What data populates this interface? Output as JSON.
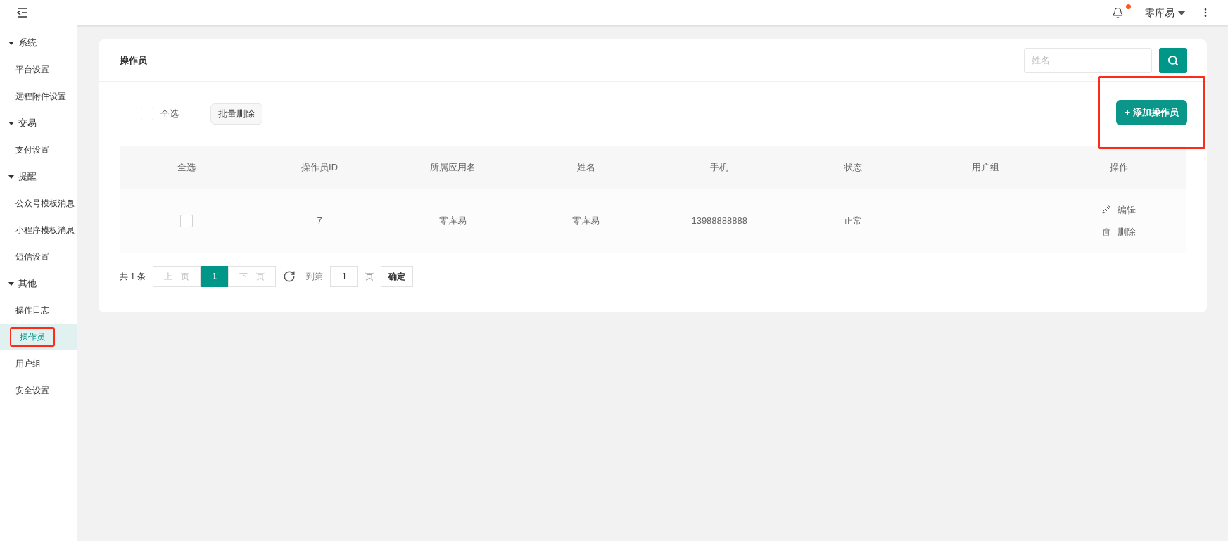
{
  "topbar": {
    "notification_dot": true,
    "user": "零库易"
  },
  "sidebar": {
    "groups": [
      {
        "label": "系统",
        "expanded": true,
        "items": [
          {
            "label": "平台设置",
            "selected": false,
            "highlighted": false
          },
          {
            "label": "远程附件设置",
            "selected": false,
            "highlighted": false
          }
        ]
      },
      {
        "label": "交易",
        "expanded": true,
        "items": [
          {
            "label": "支付设置",
            "selected": false,
            "highlighted": false
          }
        ]
      },
      {
        "label": "提醒",
        "expanded": true,
        "items": [
          {
            "label": "公众号模板消息",
            "selected": false,
            "highlighted": false
          },
          {
            "label": "小程序模板消息",
            "selected": false,
            "highlighted": false
          },
          {
            "label": "短信设置",
            "selected": false,
            "highlighted": false
          }
        ]
      },
      {
        "label": "其他",
        "expanded": true,
        "items": [
          {
            "label": "操作日志",
            "selected": false,
            "highlighted": false
          },
          {
            "label": "操作员",
            "selected": true,
            "highlighted": true
          },
          {
            "label": "用户组",
            "selected": false,
            "highlighted": false
          },
          {
            "label": "安全设置",
            "selected": false,
            "highlighted": false
          }
        ]
      }
    ]
  },
  "panel": {
    "title": "操作员",
    "search": {
      "placeholder": "姓名"
    },
    "toolbar": {
      "select_all": {
        "label": "全选",
        "checked": false
      },
      "bulk_delete": "批量删除",
      "add_button": {
        "label": "+ 添加操作员",
        "highlighted": true
      }
    },
    "table": {
      "columns": [
        "全选",
        "操作员ID",
        "所属应用名",
        "姓名",
        "手机",
        "状态",
        "用户组",
        "操作"
      ],
      "rows": [
        {
          "cells": [
            {
              "kind": "checkbox",
              "checked": false
            },
            {
              "kind": "text",
              "text": "7"
            },
            {
              "kind": "text",
              "text": "零库易"
            },
            {
              "kind": "text",
              "text": "零库易"
            },
            {
              "kind": "text",
              "text": "13988888888"
            },
            {
              "kind": "text",
              "text": "正常"
            },
            {
              "kind": "empty"
            },
            {
              "kind": "actions",
              "actions": [
                {
                  "kind": "edit",
                  "label": "编辑"
                },
                {
                  "kind": "delete",
                  "label": "删除"
                }
              ]
            }
          ]
        }
      ]
    },
    "pagination": {
      "total": "共 1 条",
      "prev": "上一页",
      "pages": [
        {
          "label": "1",
          "selected": true
        }
      ],
      "next": "下一页",
      "goto_label": "到第",
      "goto_value": "1",
      "page_unit": "页",
      "confirm": "确定"
    }
  }
}
